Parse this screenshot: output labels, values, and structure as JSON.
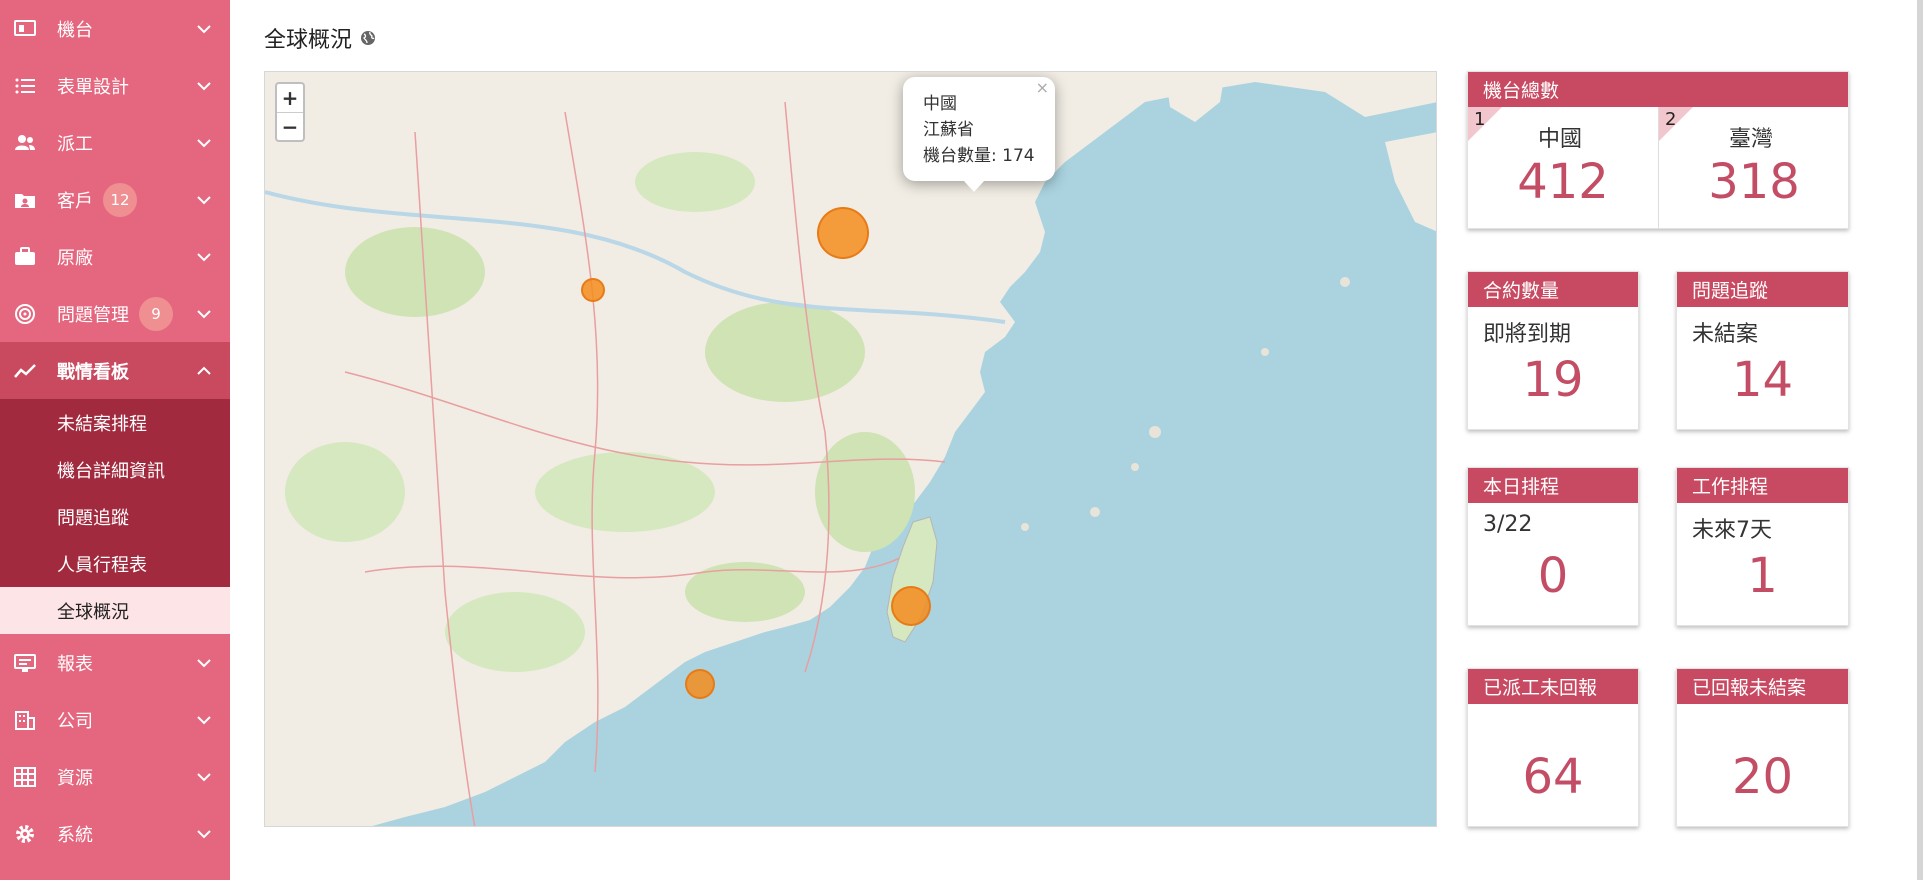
{
  "sidebar": {
    "items": [
      {
        "label": "機台",
        "icon": "machine-icon"
      },
      {
        "label": "表單設計",
        "icon": "list-icon"
      },
      {
        "label": "派工",
        "icon": "users-icon"
      },
      {
        "label": "客戶",
        "icon": "folder-user-icon",
        "badge": "12"
      },
      {
        "label": "原廠",
        "icon": "briefcase-icon"
      },
      {
        "label": "問題管理",
        "icon": "target-icon",
        "badge": "9"
      },
      {
        "label": "戰情看板",
        "icon": "chart-line-icon"
      },
      {
        "label": "報表",
        "icon": "report-icon"
      },
      {
        "label": "公司",
        "icon": "building-icon"
      },
      {
        "label": "資源",
        "icon": "grid-icon"
      },
      {
        "label": "系統",
        "icon": "gear-icon"
      }
    ],
    "submenu": [
      "未結案排程",
      "機台詳細資訊",
      "問題追蹤",
      "人員行程表",
      "全球概況"
    ]
  },
  "page": {
    "title": "全球概況"
  },
  "map": {
    "zoom_in": "+",
    "zoom_out": "−",
    "popup": {
      "country": "中國",
      "province": "江蘇省",
      "count_label": "機台數量: 174",
      "close": "×"
    }
  },
  "cards": {
    "total": {
      "title": "機台總數",
      "left": {
        "rank": "1",
        "name": "中國",
        "value": "412"
      },
      "right": {
        "rank": "2",
        "name": "臺灣",
        "value": "318"
      }
    },
    "contract": {
      "title": "合約數量",
      "sub": "即將到期",
      "value": "19"
    },
    "issue": {
      "title": "問題追蹤",
      "sub": "未結案",
      "value": "14"
    },
    "today": {
      "title": "本日排程",
      "sub": "3/22",
      "value": "0"
    },
    "work": {
      "title": "工作排程",
      "sub": "未來7天",
      "value": "1"
    },
    "dispatched": {
      "title": "已派工未回報",
      "value": "64"
    },
    "reported": {
      "title": "已回報未結案",
      "value": "20"
    }
  },
  "colors": {
    "sidebar": "#e5677f",
    "active": "#c9495f",
    "submenu": "#a22a3f",
    "card_header": "#c84a62",
    "value": "#c44d66"
  }
}
